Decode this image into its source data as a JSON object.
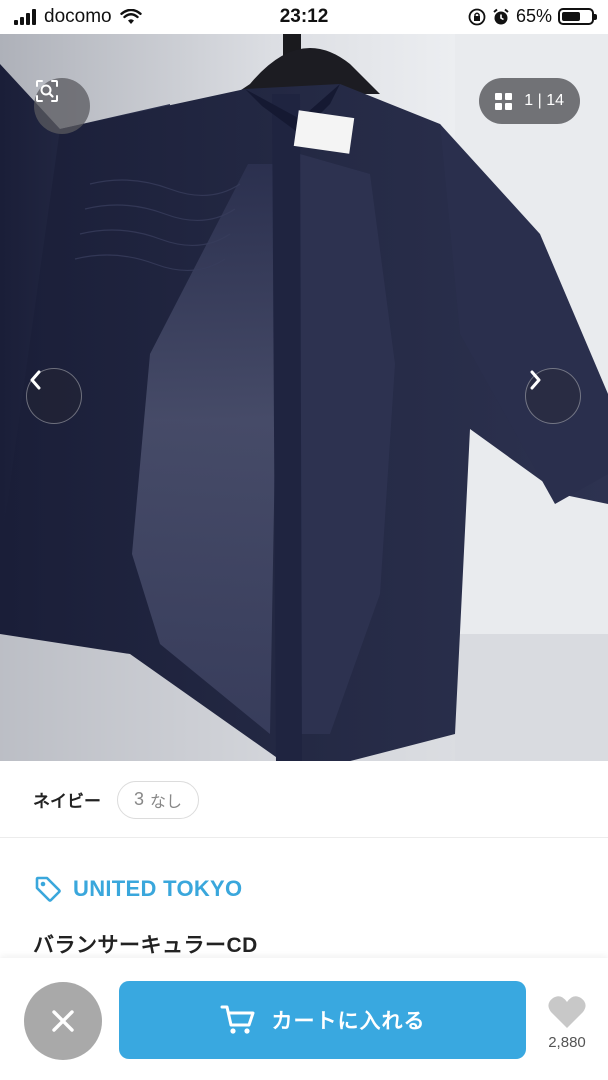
{
  "status_bar": {
    "carrier": "docomo",
    "time": "23:12",
    "battery_percent": "65%",
    "battery_level": 0.65,
    "icons": [
      "signal-icon",
      "wifi-icon",
      "orientation-lock-icon",
      "alarm-icon",
      "battery-icon"
    ]
  },
  "gallery": {
    "counter": "1 | 14",
    "current_image": 1,
    "total_images": 14,
    "icons": [
      "image-search-icon",
      "grid-icon",
      "chevron-left-icon",
      "chevron-right-icon"
    ]
  },
  "variant": {
    "color_label": "ネイビー",
    "stock_count": "3",
    "stock_suffix": "なし"
  },
  "brand": {
    "name": "UNITED TOKYO",
    "icon": "tag-icon"
  },
  "product": {
    "title": "バランサーキュラーCD"
  },
  "action_bar": {
    "cart_label": "カートに入れる",
    "like_count": "2,880",
    "icons": [
      "close-icon",
      "cart-icon",
      "heart-icon"
    ]
  },
  "colors": {
    "accent": "#39a8e0",
    "brand_text": "#3aa7dc",
    "close_button": "#a9a9a9",
    "garment": "#1f2440"
  }
}
